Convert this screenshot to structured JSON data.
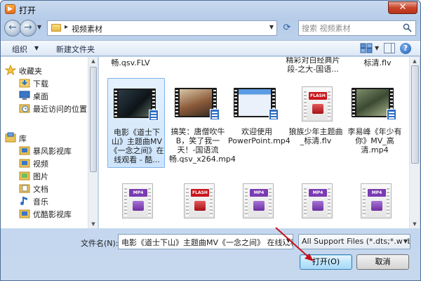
{
  "window": {
    "title": "打开",
    "close_glyph": "✕"
  },
  "nav": {
    "address": "视频素材",
    "search_placeholder": "搜索 视频素材"
  },
  "toolbar": {
    "organize": "组织",
    "new_folder": "新建文件夹"
  },
  "sidebar": {
    "items": [
      {
        "label": "收藏夹",
        "icon": "star-icon"
      },
      {
        "label": "下载",
        "icon": "download-folder-icon"
      },
      {
        "label": "桌面",
        "icon": "desktop-icon"
      },
      {
        "label": "最近访问的位置",
        "icon": "recent-places-icon"
      },
      {
        "label": "库",
        "icon": "library-icon"
      },
      {
        "label": "暴风影视库",
        "icon": "video-library-icon"
      },
      {
        "label": "视频",
        "icon": "video-library-icon"
      },
      {
        "label": "图片",
        "icon": "pictures-library-icon"
      },
      {
        "label": "文档",
        "icon": "documents-library-icon"
      },
      {
        "label": "音乐",
        "icon": "music-icon"
      },
      {
        "label": "优酷影视库",
        "icon": "video-library-icon"
      }
    ]
  },
  "files": {
    "partial_top": [
      "畅.qsv.FLV",
      "精彩对白经典片段-之大-国语...",
      "标清.flv"
    ],
    "row1": [
      {
        "name": "电影《道士下山》主题曲MV《一念之间》在线观看 - 酷...",
        "selected": true
      },
      {
        "name": "搞笑：唐僧吹牛B，笑了我一天！-国语流畅.qsv_x264.mp4"
      },
      {
        "name": "欢迎使用PowerPoint.mp4"
      },
      {
        "name": "狼族少年主题曲_标清.flv"
      },
      {
        "name": "李易峰《年少有你》MV_高清.mp4"
      }
    ],
    "row2_tags": [
      "MP4",
      "FLASH",
      "MP4",
      "MP4",
      "MP4"
    ]
  },
  "bottom": {
    "filename_label": "文件名(N):",
    "filename_value": "电影《道士下山》主题曲MV《一念之间》 在线观看",
    "filter_value": "All Support Files (*.dts;*.web",
    "open_label": "打开(O)",
    "cancel_label": "取消"
  }
}
